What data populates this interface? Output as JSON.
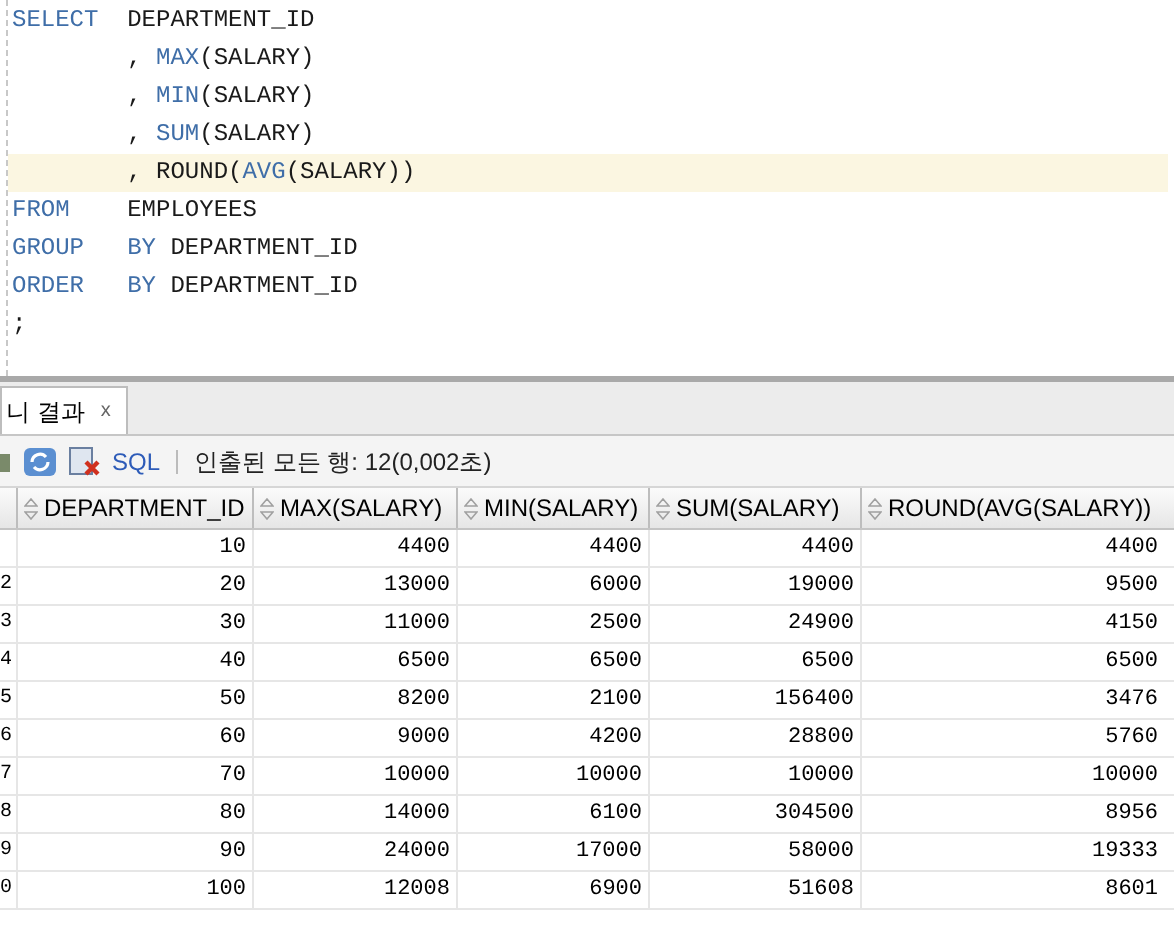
{
  "editor": {
    "lines": [
      {
        "highlighted": false,
        "segments": [
          {
            "kind": "keyword",
            "text": "SELECT  "
          },
          {
            "kind": "plain",
            "text": "DEPARTMENT_ID"
          }
        ]
      },
      {
        "highlighted": false,
        "segments": [
          {
            "kind": "plain",
            "text": "        , "
          },
          {
            "kind": "function",
            "text": "MAX"
          },
          {
            "kind": "plain",
            "text": "(SALARY)"
          }
        ]
      },
      {
        "highlighted": false,
        "segments": [
          {
            "kind": "plain",
            "text": "        , "
          },
          {
            "kind": "function",
            "text": "MIN"
          },
          {
            "kind": "plain",
            "text": "(SALARY)"
          }
        ]
      },
      {
        "highlighted": false,
        "segments": [
          {
            "kind": "plain",
            "text": "        , "
          },
          {
            "kind": "function",
            "text": "SUM"
          },
          {
            "kind": "plain",
            "text": "(SALARY)"
          }
        ]
      },
      {
        "highlighted": true,
        "segments": [
          {
            "kind": "plain",
            "text": "        , ROUND("
          },
          {
            "kind": "function",
            "text": "AVG"
          },
          {
            "kind": "plain",
            "text": "(SALARY))"
          }
        ]
      },
      {
        "highlighted": false,
        "segments": [
          {
            "kind": "keyword",
            "text": "FROM    "
          },
          {
            "kind": "plain",
            "text": "EMPLOYEES"
          }
        ]
      },
      {
        "highlighted": false,
        "segments": [
          {
            "kind": "keyword",
            "text": "GROUP   BY "
          },
          {
            "kind": "plain",
            "text": "DEPARTMENT_ID"
          }
        ]
      },
      {
        "highlighted": false,
        "segments": [
          {
            "kind": "keyword",
            "text": "ORDER   BY "
          },
          {
            "kind": "plain",
            "text": "DEPARTMENT_ID"
          }
        ]
      },
      {
        "highlighted": false,
        "segments": [
          {
            "kind": "plain",
            "text": ";"
          }
        ]
      }
    ]
  },
  "results_tab": {
    "label": "니 결과",
    "close": "x"
  },
  "toolbar": {
    "sql_link": "SQL",
    "status": "인출된 모든 행: 12(0,002초)"
  },
  "table": {
    "columns": [
      "DEPARTMENT_ID",
      "MAX(SALARY)",
      "MIN(SALARY)",
      "SUM(SALARY)",
      "ROUND(AVG(SALARY))"
    ],
    "rows": [
      {
        "row_number": "",
        "cells": [
          "10",
          "4400",
          "4400",
          "4400",
          "4400"
        ]
      },
      {
        "row_number": "2",
        "cells": [
          "20",
          "13000",
          "6000",
          "19000",
          "9500"
        ]
      },
      {
        "row_number": "3",
        "cells": [
          "30",
          "11000",
          "2500",
          "24900",
          "4150"
        ]
      },
      {
        "row_number": "4",
        "cells": [
          "40",
          "6500",
          "6500",
          "6500",
          "6500"
        ]
      },
      {
        "row_number": "5",
        "cells": [
          "50",
          "8200",
          "2100",
          "156400",
          "3476"
        ]
      },
      {
        "row_number": "6",
        "cells": [
          "60",
          "9000",
          "4200",
          "28800",
          "5760"
        ]
      },
      {
        "row_number": "7",
        "cells": [
          "70",
          "10000",
          "10000",
          "10000",
          "10000"
        ]
      },
      {
        "row_number": "8",
        "cells": [
          "80",
          "14000",
          "6100",
          "304500",
          "8956"
        ]
      },
      {
        "row_number": "9",
        "cells": [
          "90",
          "24000",
          "17000",
          "58000",
          "19333"
        ]
      },
      {
        "row_number": "0",
        "cells": [
          "100",
          "12008",
          "6900",
          "51608",
          "8601"
        ]
      }
    ]
  }
}
